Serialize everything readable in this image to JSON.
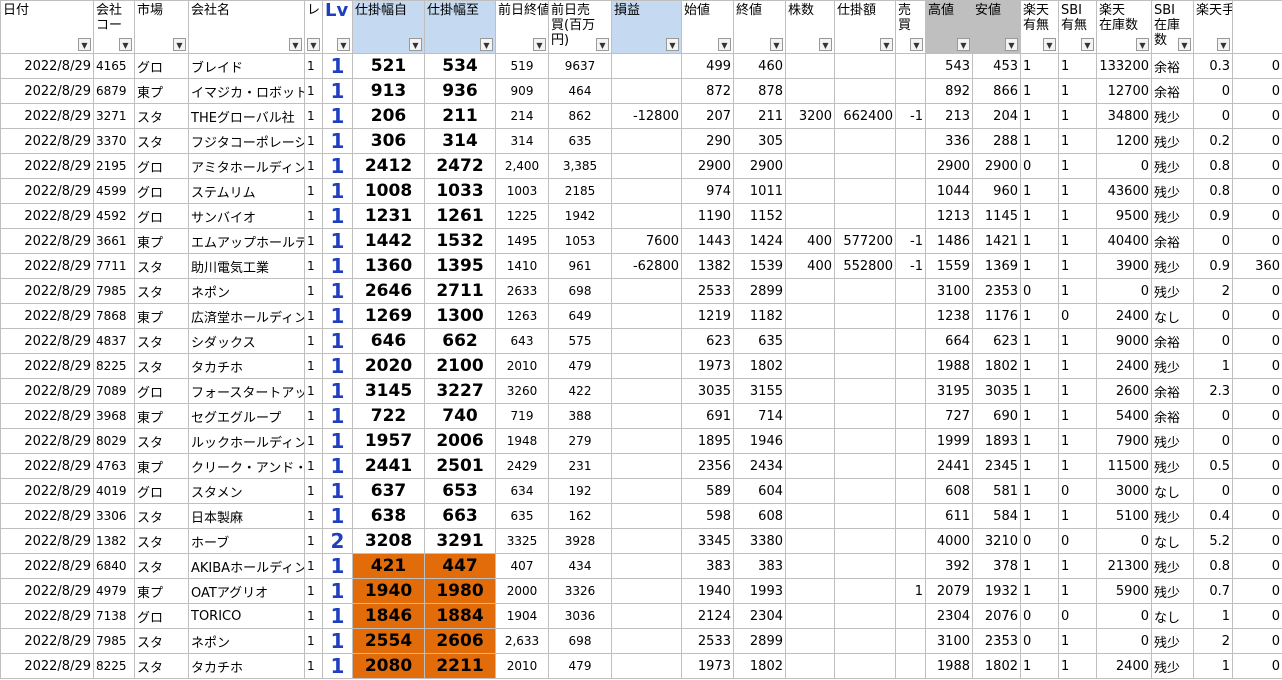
{
  "headers": [
    "日付",
    "会社コード",
    "市場",
    "会社名",
    "レ",
    "Lv",
    "仕掛幅自",
    "仕掛幅至",
    "前日終値",
    "前日売買(百万円)",
    "損益",
    "始値",
    "終値",
    "株数",
    "仕掛額",
    "売買",
    "高値",
    "安値",
    "楽天有無",
    "SBI有無",
    "楽天在庫数",
    "SBI在庫数",
    "楽天手数料"
  ],
  "header_display": [
    "日付",
    "会社\nコー",
    "市場",
    "会社名",
    "レ",
    "Lv",
    "仕掛幅自",
    "仕掛幅至",
    "前日終値",
    "前日売\n買(百万\n円)",
    "損益",
    "始値",
    "終値",
    "株数",
    "仕掛額",
    "売\n買",
    "高値",
    "安値",
    "楽天\n有無",
    "SBI\n有無",
    "楽天\n在庫数",
    "SBI\n在庫\n数",
    "楽天手数料"
  ],
  "rows": [
    [
      "2022/8/29",
      "4165",
      "グロ",
      "ブレイド",
      "1",
      "1",
      "521",
      "534",
      "519",
      "9637",
      "",
      "499",
      "460",
      "",
      "",
      "",
      "543",
      "453",
      "1",
      "1",
      "133200",
      "余裕",
      "0.3",
      "0"
    ],
    [
      "2022/8/29",
      "6879",
      "東プ",
      "イマジカ・ロボット",
      "1",
      "1",
      "913",
      "936",
      "909",
      "464",
      "",
      "872",
      "878",
      "",
      "",
      "",
      "892",
      "866",
      "1",
      "1",
      "12700",
      "余裕",
      "0",
      "0"
    ],
    [
      "2022/8/29",
      "3271",
      "スタ",
      "THEグローバル社",
      "1",
      "1",
      "206",
      "211",
      "214",
      "862",
      "-12800",
      "207",
      "211",
      "3200",
      "662400",
      "-1",
      "213",
      "204",
      "1",
      "1",
      "34800",
      "残少",
      "0",
      "0"
    ],
    [
      "2022/8/29",
      "3370",
      "スタ",
      "フジタコーポレーション",
      "1",
      "1",
      "306",
      "314",
      "314",
      "635",
      "",
      "290",
      "305",
      "",
      "",
      "",
      "336",
      "288",
      "1",
      "1",
      "1200",
      "残少",
      "0.2",
      "0"
    ],
    [
      "2022/8/29",
      "2195",
      "グロ",
      "アミタホールディングス",
      "1",
      "1",
      "2412",
      "2472",
      "2,400",
      "3,385",
      "",
      "2900",
      "2900",
      "",
      "",
      "",
      "2900",
      "2900",
      "0",
      "1",
      "0",
      "残少",
      "0.8",
      "0"
    ],
    [
      "2022/8/29",
      "4599",
      "グロ",
      "ステムリム",
      "1",
      "1",
      "1008",
      "1033",
      "1003",
      "2185",
      "",
      "974",
      "1011",
      "",
      "",
      "",
      "1044",
      "960",
      "1",
      "1",
      "43600",
      "残少",
      "0.8",
      "0"
    ],
    [
      "2022/8/29",
      "4592",
      "グロ",
      "サンバイオ",
      "1",
      "1",
      "1231",
      "1261",
      "1225",
      "1942",
      "",
      "1190",
      "1152",
      "",
      "",
      "",
      "1213",
      "1145",
      "1",
      "1",
      "9500",
      "残少",
      "0.9",
      "0"
    ],
    [
      "2022/8/29",
      "3661",
      "東プ",
      "エムアップホールディングス",
      "1",
      "1",
      "1442",
      "1532",
      "1495",
      "1053",
      "7600",
      "1443",
      "1424",
      "400",
      "577200",
      "-1",
      "1486",
      "1421",
      "1",
      "1",
      "40400",
      "余裕",
      "0",
      "0"
    ],
    [
      "2022/8/29",
      "7711",
      "スタ",
      "助川電気工業",
      "1",
      "1",
      "1360",
      "1395",
      "1410",
      "961",
      "-62800",
      "1382",
      "1539",
      "400",
      "552800",
      "-1",
      "1559",
      "1369",
      "1",
      "1",
      "3900",
      "残少",
      "0.9",
      "360"
    ],
    [
      "2022/8/29",
      "7985",
      "スタ",
      "ネポン",
      "1",
      "1",
      "2646",
      "2711",
      "2633",
      "698",
      "",
      "2533",
      "2899",
      "",
      "",
      "",
      "3100",
      "2353",
      "0",
      "1",
      "0",
      "残少",
      "2",
      "0"
    ],
    [
      "2022/8/29",
      "7868",
      "東プ",
      "広済堂ホールディングス",
      "1",
      "1",
      "1269",
      "1300",
      "1263",
      "649",
      "",
      "1219",
      "1182",
      "",
      "",
      "",
      "1238",
      "1176",
      "1",
      "0",
      "2400",
      "なし",
      "0",
      "0"
    ],
    [
      "2022/8/29",
      "4837",
      "スタ",
      "シダックス",
      "1",
      "1",
      "646",
      "662",
      "643",
      "575",
      "",
      "623",
      "635",
      "",
      "",
      "",
      "664",
      "623",
      "1",
      "1",
      "9000",
      "余裕",
      "0",
      "0"
    ],
    [
      "2022/8/29",
      "8225",
      "スタ",
      "タカチホ",
      "1",
      "1",
      "2020",
      "2100",
      "2010",
      "479",
      "",
      "1973",
      "1802",
      "",
      "",
      "",
      "1988",
      "1802",
      "1",
      "1",
      "2400",
      "残少",
      "1",
      "0"
    ],
    [
      "2022/8/29",
      "7089",
      "グロ",
      "フォースタートアップス",
      "1",
      "1",
      "3145",
      "3227",
      "3260",
      "422",
      "",
      "3035",
      "3155",
      "",
      "",
      "",
      "3195",
      "3035",
      "1",
      "1",
      "2600",
      "余裕",
      "2.3",
      "0"
    ],
    [
      "2022/8/29",
      "3968",
      "東プ",
      "セグエグループ",
      "1",
      "1",
      "722",
      "740",
      "719",
      "388",
      "",
      "691",
      "714",
      "",
      "",
      "",
      "727",
      "690",
      "1",
      "1",
      "5400",
      "余裕",
      "0",
      "0"
    ],
    [
      "2022/8/29",
      "8029",
      "スタ",
      "ルックホールディングス",
      "1",
      "1",
      "1957",
      "2006",
      "1948",
      "279",
      "",
      "1895",
      "1946",
      "",
      "",
      "",
      "1999",
      "1893",
      "1",
      "1",
      "7900",
      "残少",
      "0",
      "0"
    ],
    [
      "2022/8/29",
      "4763",
      "東プ",
      "クリーク・アンド・リバー社",
      "1",
      "1",
      "2441",
      "2501",
      "2429",
      "231",
      "",
      "2356",
      "2434",
      "",
      "",
      "",
      "2441",
      "2345",
      "1",
      "1",
      "11500",
      "残少",
      "0.5",
      "0"
    ],
    [
      "2022/8/29",
      "4019",
      "グロ",
      "スタメン",
      "1",
      "1",
      "637",
      "653",
      "634",
      "192",
      "",
      "589",
      "604",
      "",
      "",
      "",
      "608",
      "581",
      "1",
      "0",
      "3000",
      "なし",
      "0",
      "0"
    ],
    [
      "2022/8/29",
      "3306",
      "スタ",
      "日本製麻",
      "1",
      "1",
      "638",
      "663",
      "635",
      "162",
      "",
      "598",
      "608",
      "",
      "",
      "",
      "611",
      "584",
      "1",
      "1",
      "5100",
      "残少",
      "0.4",
      "0"
    ],
    [
      "2022/8/29",
      "1382",
      "スタ",
      "ホーブ",
      "1",
      "2",
      "3208",
      "3291",
      "3325",
      "3928",
      "",
      "3345",
      "3380",
      "",
      "",
      "",
      "4000",
      "3210",
      "0",
      "0",
      "0",
      "なし",
      "5.2",
      "0"
    ],
    [
      "2022/8/29",
      "6840",
      "スタ",
      "AKIBAホールディングス",
      "1",
      "1",
      "421",
      "447",
      "407",
      "434",
      "",
      "383",
      "383",
      "",
      "",
      "",
      "392",
      "378",
      "1",
      "1",
      "21300",
      "残少",
      "0.8",
      "0"
    ],
    [
      "2022/8/29",
      "4979",
      "東プ",
      "OATアグリオ",
      "1",
      "1",
      "1940",
      "1980",
      "2000",
      "3326",
      "",
      "1940",
      "1993",
      "",
      "",
      "1",
      "2079",
      "1932",
      "1",
      "1",
      "5900",
      "残少",
      "0.7",
      "0"
    ],
    [
      "2022/8/29",
      "7138",
      "グロ",
      "TORICO",
      "1",
      "1",
      "1846",
      "1884",
      "1904",
      "3036",
      "",
      "2124",
      "2304",
      "",
      "",
      "",
      "2304",
      "2076",
      "0",
      "0",
      "0",
      "なし",
      "1",
      "0"
    ],
    [
      "2022/8/29",
      "7985",
      "スタ",
      "ネポン",
      "1",
      "1",
      "2554",
      "2606",
      "2,633",
      "698",
      "",
      "2533",
      "2899",
      "",
      "",
      "",
      "3100",
      "2353",
      "0",
      "1",
      "0",
      "残少",
      "2",
      "0"
    ],
    [
      "2022/8/29",
      "8225",
      "スタ",
      "タカチホ",
      "1",
      "1",
      "2080",
      "2211",
      "2010",
      "479",
      "",
      "1973",
      "1802",
      "",
      "",
      "",
      "1988",
      "1802",
      "1",
      "1",
      "2400",
      "残少",
      "1",
      "0"
    ]
  ],
  "highlight_rows_from": 20,
  "colors": {
    "header_blue": "#c5d9f1",
    "header_gray": "#bfbfbf",
    "orange": "#e26b0a",
    "lv_blue": "#1f3fbf"
  }
}
